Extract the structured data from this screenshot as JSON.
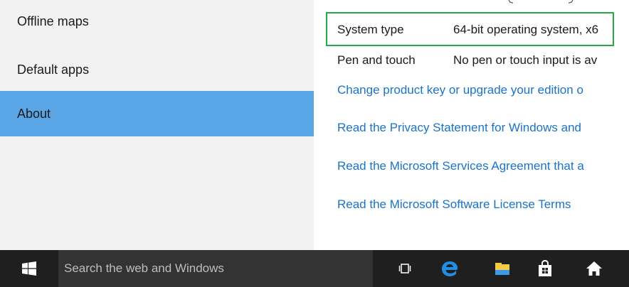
{
  "nav": {
    "items": [
      {
        "label": "Offline maps"
      },
      {
        "label": "Default apps"
      },
      {
        "label": "About",
        "selected": true
      }
    ]
  },
  "about": {
    "system_type": {
      "label": "System type",
      "value": "64-bit operating system, x6"
    },
    "pen_touch": {
      "label": "Pen and touch",
      "value": "No pen or touch input is av"
    },
    "links": [
      "Change product key or upgrade your edition o",
      "Read the Privacy Statement for Windows and",
      "Read the Microsoft Services Agreement that a",
      "Read the Microsoft Software License Terms"
    ]
  },
  "taskbar": {
    "search_placeholder": "Search the web and Windows",
    "icons": [
      "windows-start-icon",
      "task-view-icon",
      "edge-icon",
      "file-explorer-icon",
      "store-icon",
      "home-icon"
    ]
  },
  "colors": {
    "nav_background": "#f2f2f2",
    "selected_background": "#5aa5e6",
    "link": "#1a73c9",
    "highlight_border": "#28a745",
    "taskbar": "#1f1f1f",
    "search_box": "#333333"
  }
}
